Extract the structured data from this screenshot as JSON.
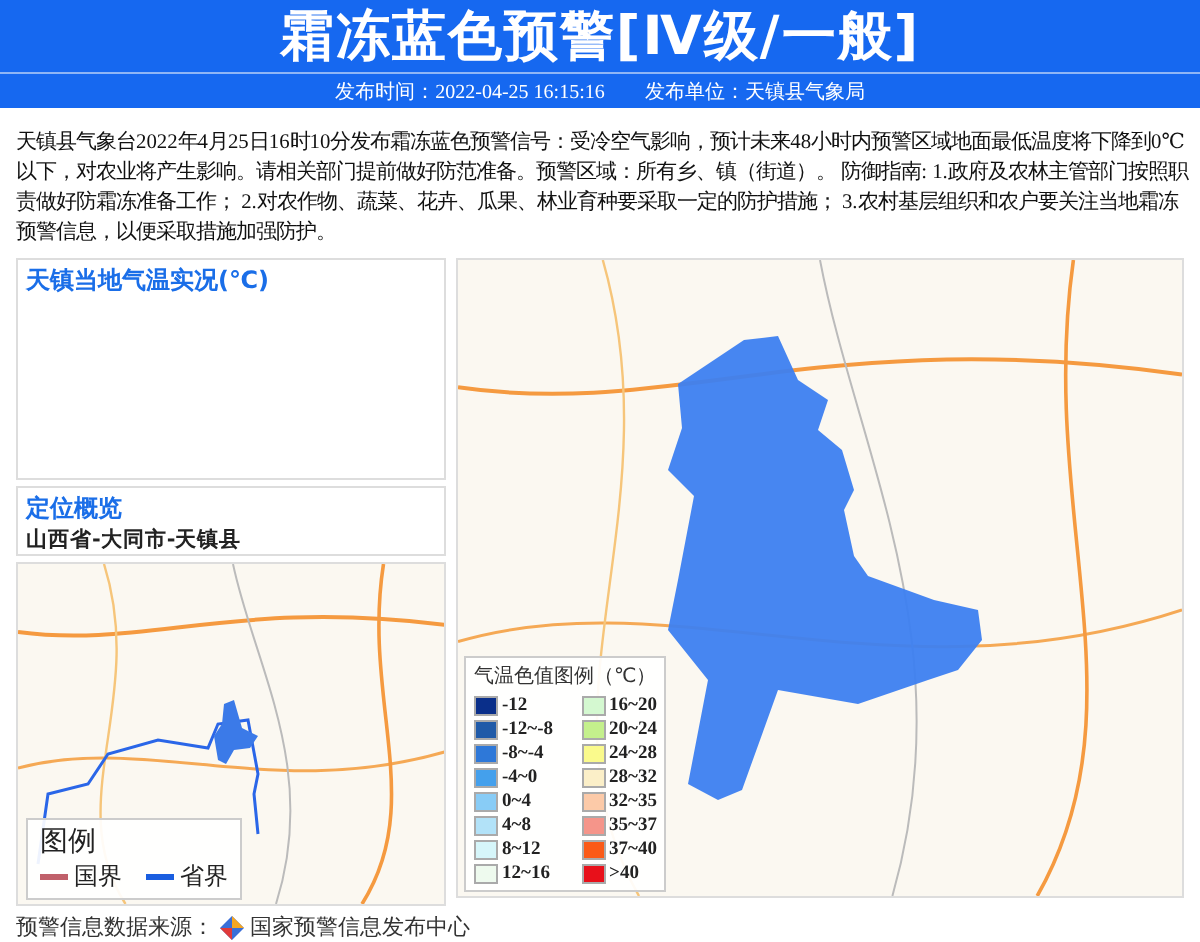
{
  "header": {
    "title": "霜冻蓝色预警[Ⅳ级/一般]",
    "publish_time": "发布时间：2022-04-25 16:15:16",
    "publish_unit": "发布单位：天镇县气象局"
  },
  "description": "天镇县气象台2022年4月25日16时10分发布霜冻蓝色预警信号：受冷空气影响，预计未来48小时内预警区域地面最低温度将下降到0℃以下，对农业将产生影响。请相关部门提前做好防范准备。预警区域：所有乡、镇（街道）。 防御指南: 1.政府及农林主管部门按照职责做好防霜冻准备工作； 2.对农作物、蔬菜、花卉、瓜果、林业育种要采取一定的防护措施； 3.农村基层组织和农户要关注当地霜冻预警信息，以便采取措施加强防护。",
  "temperature_panel": {
    "title": "天镇当地气温实况(℃)"
  },
  "location_panel": {
    "title": "定位概览",
    "path": "山西省-大同市-天镇县"
  },
  "overview_legend": {
    "title": "图例",
    "items": [
      {
        "label": "国界",
        "color": "#c0606a"
      },
      {
        "label": "省界",
        "color": "#1a5ee0"
      }
    ]
  },
  "temperature_legend": {
    "title": "气温色值图例（℃）",
    "items": [
      {
        "label": "-12",
        "color": "#0a2f8a"
      },
      {
        "label": "-12~-8",
        "color": "#1f5aa8"
      },
      {
        "label": "-8~-4",
        "color": "#2e78d8"
      },
      {
        "label": "-4~0",
        "color": "#44a0ec"
      },
      {
        "label": "0~4",
        "color": "#88ccf6"
      },
      {
        "label": "4~8",
        "color": "#b2e2f8"
      },
      {
        "label": "8~12",
        "color": "#d6f6fa"
      },
      {
        "label": "12~16",
        "color": "#eefaee"
      },
      {
        "label": "16~20",
        "color": "#d4f8d0"
      },
      {
        "label": "20~24",
        "color": "#c4f08c"
      },
      {
        "label": "24~28",
        "color": "#fafa8c"
      },
      {
        "label": "28~32",
        "color": "#fbefc8"
      },
      {
        "label": "32~35",
        "color": "#fccaa8"
      },
      {
        "label": "35~37",
        "color": "#f5958a"
      },
      {
        "label": "37~40",
        "color": "#fa5a18"
      },
      {
        "label": ">40",
        "color": "#e8101a"
      }
    ]
  },
  "footer": {
    "source_label": "预警信息数据来源：",
    "source_name": "国家预警信息发布中心"
  }
}
